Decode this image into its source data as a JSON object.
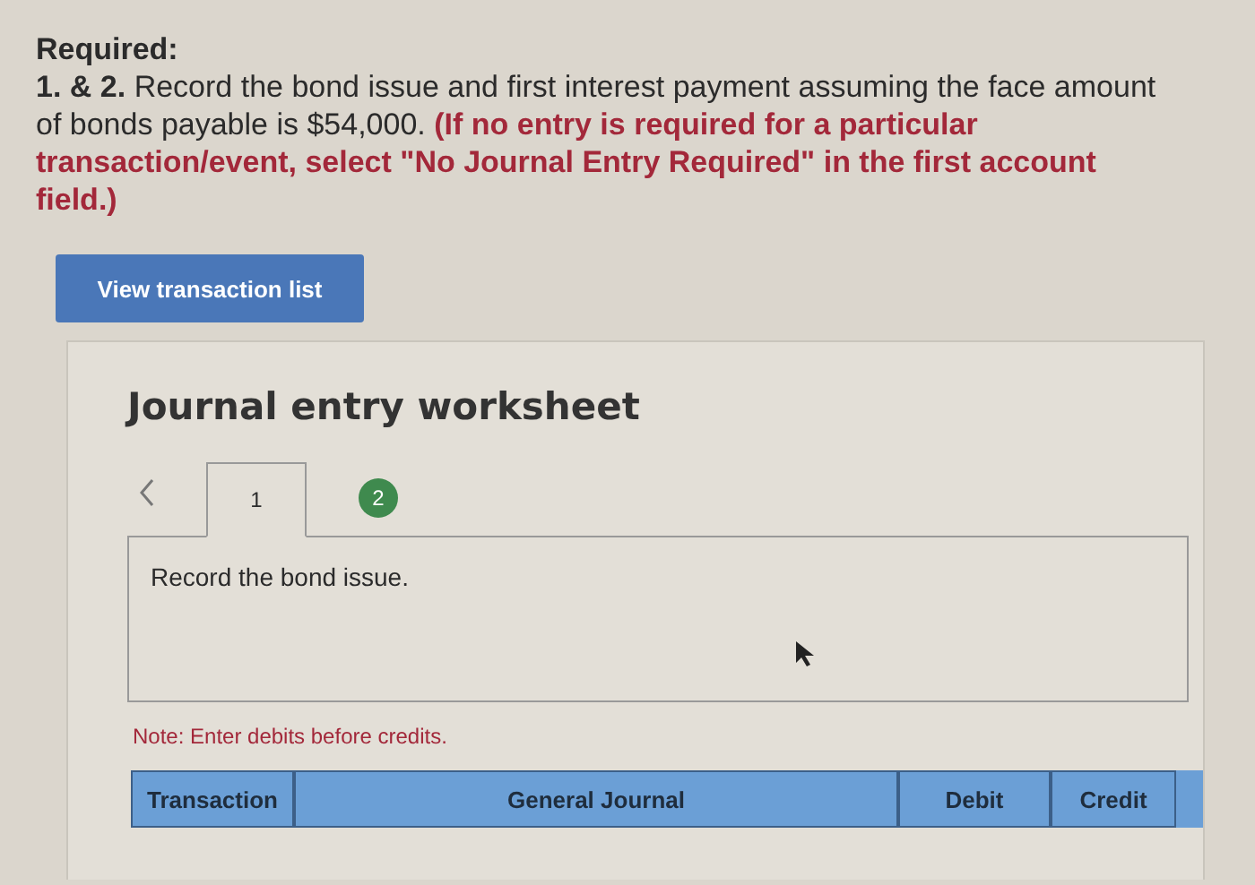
{
  "required_label": "Required:",
  "question": {
    "text": "**1. & 2.** Record the bond issue and first interest payment assuming the face amount of bonds payable is $54,000.",
    "instruction": "(If no entry is required for a particular transaction/event, select \"No Journal Entry Required\" in the first account field.)"
  },
  "view_button": "View transaction list",
  "worksheet": {
    "title": "Journal entry worksheet",
    "tabs": [
      {
        "label": "1",
        "selected": true,
        "completed": false
      },
      {
        "label": "2",
        "selected": false,
        "completed": true
      }
    ],
    "prompt": "Record the bond issue.",
    "note": "Note: Enter debits before credits.",
    "columns": [
      "Transaction",
      "General Journal",
      "Debit",
      "Credit"
    ]
  }
}
